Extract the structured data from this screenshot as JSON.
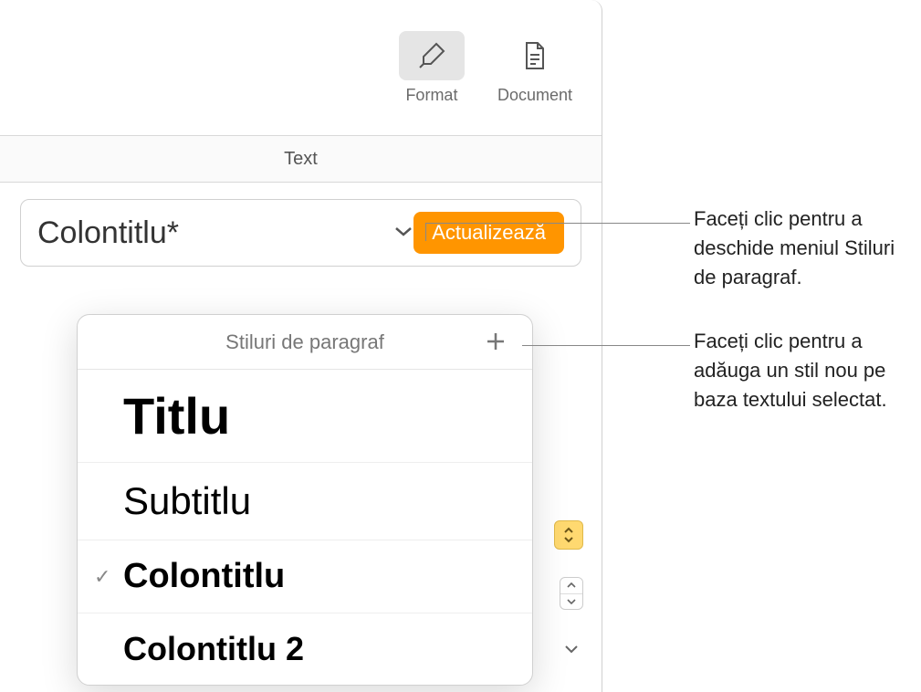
{
  "toolbar": {
    "format_label": "Format",
    "document_label": "Document"
  },
  "section": {
    "text_label": "Text"
  },
  "style_picker": {
    "current_style": "Colontitlu*",
    "update_label": "Actualizează"
  },
  "popover": {
    "title": "Stiluri de paragraf",
    "styles": [
      {
        "label": "Titlu",
        "selected": false
      },
      {
        "label": "Subtitlu",
        "selected": false
      },
      {
        "label": "Colontitlu",
        "selected": true
      },
      {
        "label": "Colontitlu 2",
        "selected": false
      }
    ]
  },
  "callouts": {
    "open_menu": "Faceți clic pentru a deschide meniul Stiluri de paragraf.",
    "add_style": "Faceți clic pentru a adăuga un stil nou pe baza textului selectat."
  }
}
